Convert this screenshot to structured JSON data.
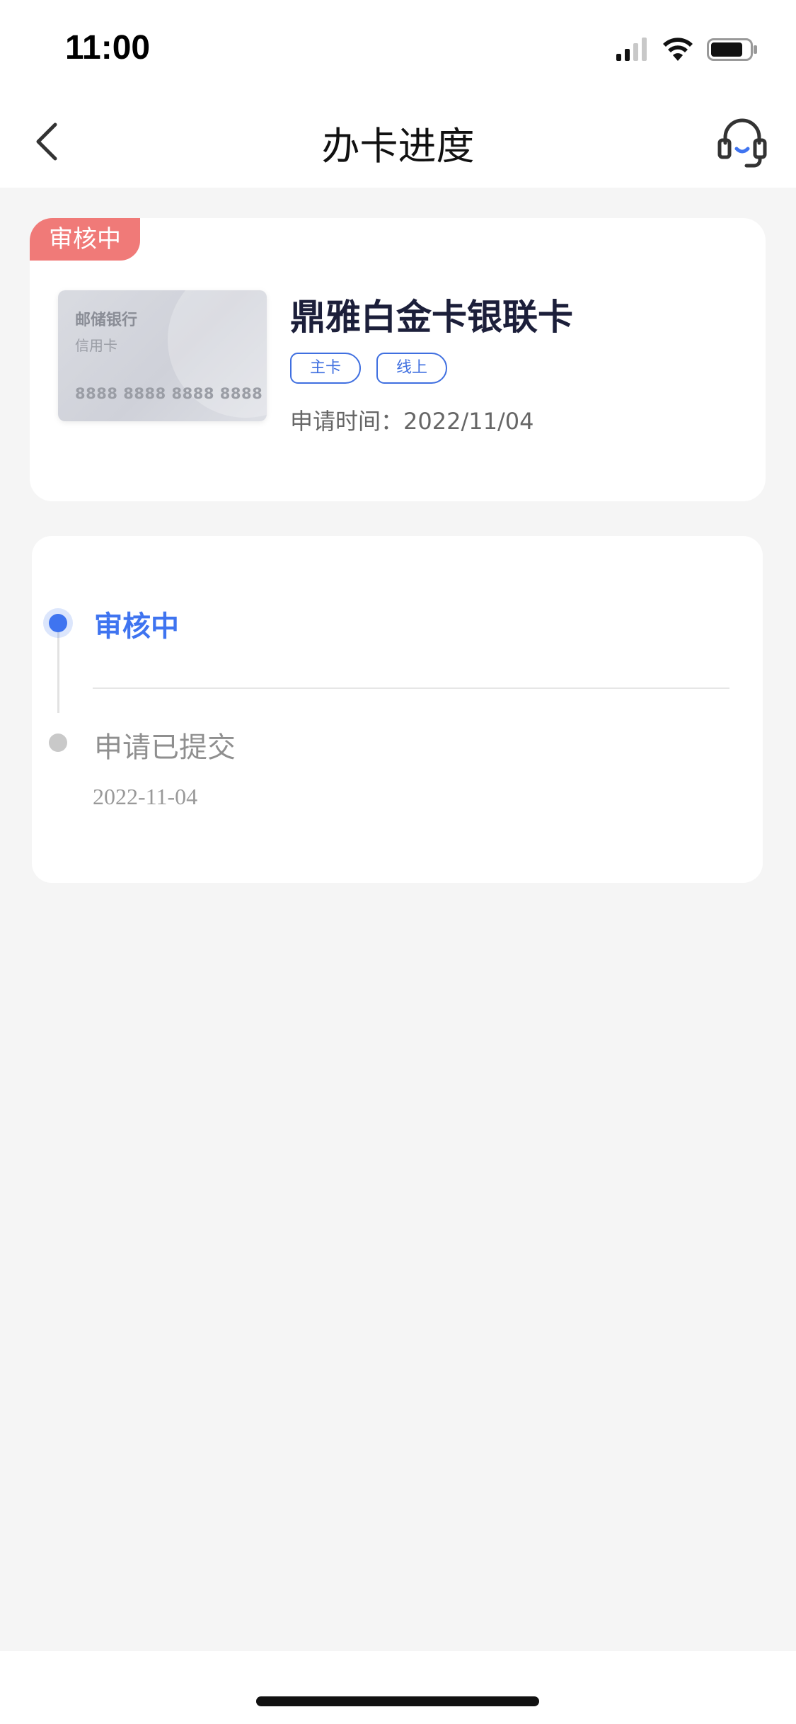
{
  "status_bar": {
    "time": "11:00"
  },
  "nav": {
    "title": "办卡进度"
  },
  "card": {
    "status_tag": "审核中",
    "image": {
      "bank": "邮储银行",
      "type": "信用卡",
      "number": "8888 8888 8888 8888"
    },
    "name": "鼎雅白金卡银联卡",
    "tags": [
      "主卡",
      "线上"
    ],
    "apply_time": "申请时间：2022/11/04"
  },
  "progress": {
    "steps": [
      {
        "label": "审核中",
        "date": ""
      },
      {
        "label": "申请已提交",
        "date": "2022-11-04"
      }
    ],
    "accent_color": "#3f74f0"
  },
  "colors": {
    "status_tag": "#f07a78",
    "tag_border": "#3f6fe0",
    "card_name": "#1c1f3a"
  }
}
